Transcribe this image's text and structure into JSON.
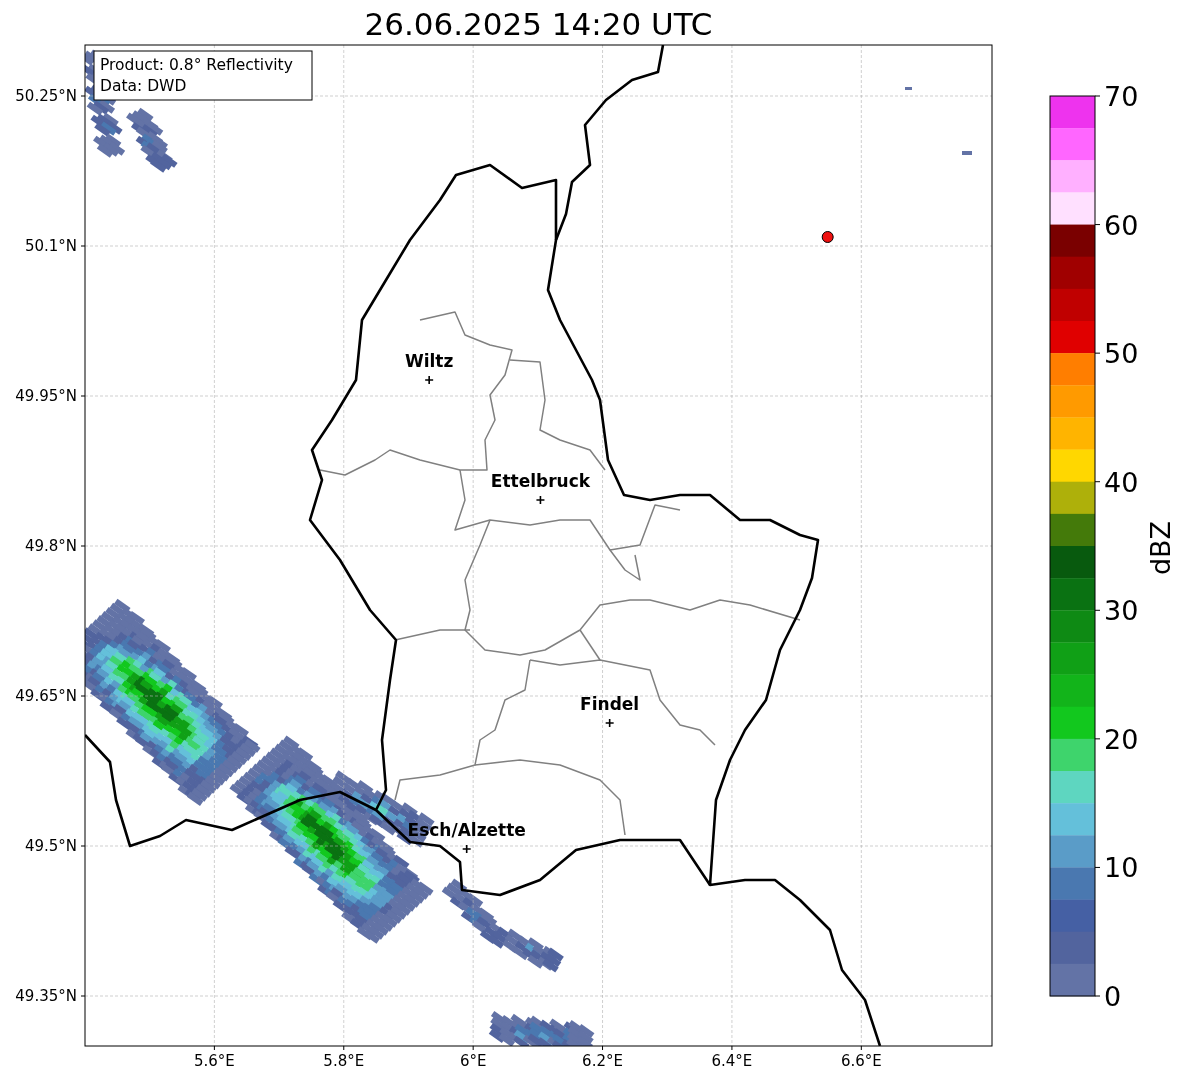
{
  "title": "26.06.2025 14:20 UTC",
  "info_box": [
    "Product: 0.8° Reflectivity",
    "Data: DWD"
  ],
  "map": {
    "lat_labels": [
      "50.25°N",
      "50.1°N",
      "49.95°N",
      "49.8°N",
      "49.65°N",
      "49.5°N",
      "49.35°N"
    ],
    "lon_labels": [
      "5.6°E",
      "5.8°E",
      "6°E",
      "6.2°E",
      "6.4°E",
      "6.6°E"
    ],
    "cities": [
      {
        "name": "Wiltz"
      },
      {
        "name": "Ettelbruck"
      },
      {
        "name": "Findel"
      },
      {
        "name": "Esch/Alzette"
      }
    ]
  },
  "colorbar": {
    "label": "dBZ",
    "ticks": [
      "70",
      "60",
      "50",
      "40",
      "30",
      "20",
      "10",
      "0"
    ],
    "segments": [
      {
        "color": "#ee33ee"
      },
      {
        "color": "#ff66ff"
      },
      {
        "color": "#ffb0ff"
      },
      {
        "color": "#ffe0ff"
      },
      {
        "color": "#7a0000"
      },
      {
        "color": "#a00000"
      },
      {
        "color": "#c00000"
      },
      {
        "color": "#e00000"
      },
      {
        "color": "#ff7e00"
      },
      {
        "color": "#ff9a00"
      },
      {
        "color": "#ffb400"
      },
      {
        "color": "#ffd700"
      },
      {
        "color": "#aeb00a"
      },
      {
        "color": "#447a0a"
      },
      {
        "color": "#085a0e"
      },
      {
        "color": "#0a7212"
      },
      {
        "color": "#0e8a14"
      },
      {
        "color": "#10a016"
      },
      {
        "color": "#12b41a"
      },
      {
        "color": "#12c81e"
      },
      {
        "color": "#3ed46c"
      },
      {
        "color": "#5ed6c0"
      },
      {
        "color": "#64c0da"
      },
      {
        "color": "#5a9cc8"
      },
      {
        "color": "#4a78b0"
      },
      {
        "color": "#4560a4"
      },
      {
        "color": "#52649e"
      },
      {
        "color": "#6373a6"
      }
    ]
  }
}
